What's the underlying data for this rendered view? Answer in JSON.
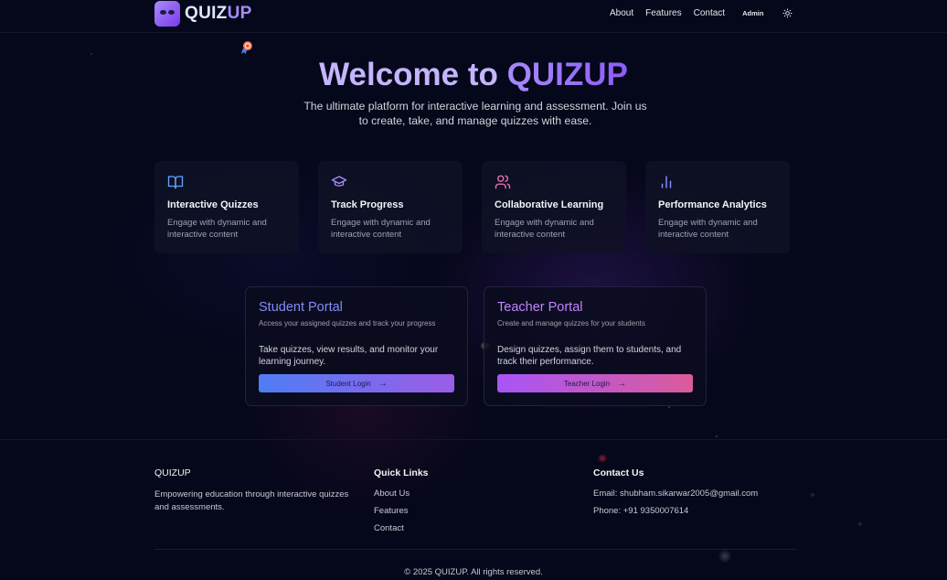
{
  "header": {
    "logo_part1": "QUIZ",
    "logo_part2": "UP",
    "nav": [
      "About",
      "Features",
      "Contact"
    ],
    "admin": "Admin",
    "theme_icon": "sun-icon"
  },
  "hero": {
    "title_part1": "Welcome to ",
    "title_part2": "QUIZUP",
    "subtitle": "The ultimate platform for interactive learning and assessment. Join us to create, take, and manage quizzes with ease."
  },
  "features": [
    {
      "icon": "book-open-icon",
      "title": "Interactive Quizzes",
      "desc": "Engage with dynamic and interactive content",
      "color": "#60a5fa"
    },
    {
      "icon": "graduation-cap-icon",
      "title": "Track Progress",
      "desc": "Engage with dynamic and interactive content",
      "color": "#a78bfa"
    },
    {
      "icon": "users-icon",
      "title": "Collaborative Learning",
      "desc": "Engage with dynamic and interactive content",
      "color": "#f472b6"
    },
    {
      "icon": "bar-chart-icon",
      "title": "Performance Analytics",
      "desc": "Engage with dynamic and interactive content",
      "color": "#818cf8"
    }
  ],
  "portals": {
    "student": {
      "title": "Student Portal",
      "subtitle": "Access your assigned quizzes and track your progress",
      "desc": "Take quizzes, view results, and monitor your learning journey.",
      "button": "Student Login"
    },
    "teacher": {
      "title": "Teacher Portal",
      "subtitle": "Create and manage quizzes for your students",
      "desc": "Design quizzes, assign them to students, and track their performance.",
      "button": "Teacher Login"
    }
  },
  "footer": {
    "brand": "QUIZUP",
    "brand_desc": "Empowering education through interactive quizzes and assessments.",
    "quick_links_title": "Quick Links",
    "quick_links": [
      "About Us",
      "Features",
      "Contact"
    ],
    "contact_title": "Contact Us",
    "email": "Email: shubham.sikarwar2005@gmail.com",
    "phone": "Phone: +91 9350007614",
    "copyright": "© 2025 QUIZUP. All rights reserved."
  }
}
